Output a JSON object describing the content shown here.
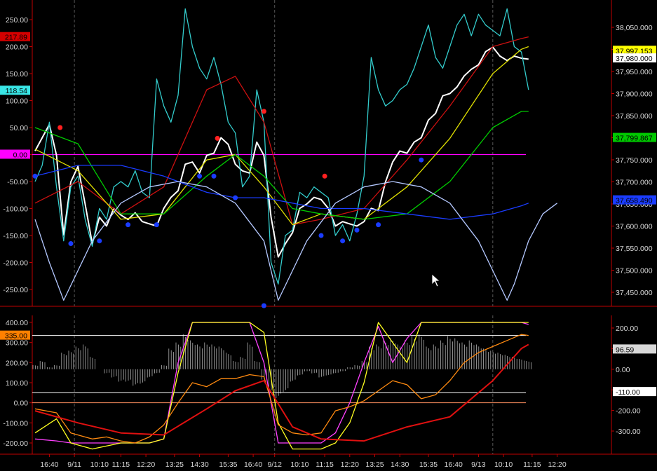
{
  "chart_data": [
    {
      "type": "line",
      "panel": "price",
      "left_axis": {
        "ticks": [
          250,
          200,
          150,
          100,
          50,
          0,
          -50,
          -100,
          -150,
          -200,
          -250
        ],
        "labels": [
          "250.00",
          "200.00",
          "150.00",
          "100.00",
          "50.00",
          "0.00",
          "-50.00",
          "-100.00",
          "-150.00",
          "-200.00",
          "-250.00"
        ]
      },
      "right_axis": {
        "ticks": [
          38050,
          38000,
          37950,
          37900,
          37850,
          37800,
          37750,
          37700,
          37650,
          37600,
          37550,
          37500,
          37450
        ],
        "labels": [
          "38,050.000",
          "38,000.000",
          "37,950.000",
          "37,900.000",
          "37,850.000",
          "37,800.000",
          "37,750.000",
          "37,700.000",
          "37,650.000",
          "37,600.000",
          "37,550.000",
          "37,500.000",
          "37,450.000"
        ]
      },
      "left_tags": [
        {
          "text": "217.89",
          "value": 217.89,
          "bg": "#d40000",
          "fg": "#000000"
        },
        {
          "text": "118.54",
          "value": 118.54,
          "bg": "#39e6e6",
          "fg": "#000000"
        },
        {
          "text": "0.00",
          "value": 0,
          "bg": "#ff00ff",
          "fg": "#000000"
        }
      ],
      "right_tags": [
        {
          "text": "37,997.153",
          "value": 37997.153,
          "bg": "#ffff00",
          "fg": "#000000"
        },
        {
          "text": "37,980.000",
          "value": 37980,
          "bg": "#ffffff",
          "fg": "#000000"
        },
        {
          "text": "37,799.867",
          "value": 37799.867,
          "bg": "#00c800",
          "fg": "#000000"
        },
        {
          "text": "37,658.490",
          "value": 37658.49,
          "bg": "#1a3cff",
          "fg": "#000000"
        }
      ],
      "series": [
        {
          "name": "price",
          "color": "#ffffff",
          "x": [
            0,
            1,
            2,
            3,
            4,
            5,
            6,
            7,
            8,
            9,
            10,
            11,
            12,
            13,
            14,
            15,
            16,
            17,
            18,
            19,
            20,
            21,
            22,
            23,
            24,
            25,
            26,
            27,
            28,
            29,
            30,
            31,
            32,
            33,
            34,
            35,
            36,
            37,
            38,
            39,
            40,
            41,
            42,
            43,
            44,
            45,
            46,
            47,
            48,
            49,
            50,
            51,
            52,
            53,
            54,
            55,
            56,
            57,
            58,
            59,
            60,
            61,
            62,
            63,
            64,
            65,
            66,
            67,
            68,
            69
          ],
          "y": [
            37770,
            37800,
            37830,
            37760,
            37580,
            37700,
            37735,
            37650,
            37560,
            37620,
            37600,
            37640,
            37625,
            37615,
            37630,
            37610,
            37605,
            37600,
            37640,
            37665,
            37680,
            37740,
            37745,
            37720,
            37760,
            37765,
            37800,
            37785,
            37740,
            37725,
            37720,
            37790,
            37760,
            37620,
            37530,
            37560,
            37585,
            37640,
            37650,
            37665,
            37660,
            37640,
            37600,
            37610,
            37605,
            37600,
            37610,
            37640,
            37635,
            37700,
            37745,
            37770,
            37765,
            37790,
            37800,
            37840,
            37855,
            37895,
            37900,
            37915,
            37940,
            37955,
            37965,
            37995,
            38005,
            37985,
            37975,
            37985,
            37980,
            37978
          ]
        },
        {
          "name": "oscillator",
          "color": "#33cccc",
          "x": [
            0,
            1,
            2,
            3,
            4,
            5,
            6,
            7,
            8,
            9,
            10,
            11,
            12,
            13,
            14,
            15,
            16,
            17,
            18,
            19,
            20,
            21,
            22,
            23,
            24,
            25,
            26,
            27,
            28,
            29,
            30,
            31,
            32,
            33,
            34,
            35,
            36,
            37,
            38,
            39,
            40,
            41,
            42,
            43,
            44,
            45,
            46,
            47,
            48,
            49,
            50,
            51,
            52,
            53,
            54,
            55,
            56,
            57,
            58,
            59,
            60,
            61,
            62,
            63,
            64,
            65,
            66,
            67,
            68,
            69
          ],
          "y": [
            -50,
            -20,
            60,
            -60,
            -160,
            -60,
            -40,
            -120,
            -170,
            -100,
            -120,
            -60,
            -50,
            -60,
            -30,
            -70,
            -80,
            140,
            90,
            60,
            110,
            270,
            200,
            160,
            140,
            180,
            130,
            60,
            40,
            -60,
            -40,
            120,
            60,
            -200,
            -240,
            -150,
            -140,
            -70,
            -80,
            -60,
            -70,
            -80,
            -150,
            -130,
            -160,
            -110,
            -40,
            180,
            120,
            90,
            100,
            120,
            130,
            160,
            200,
            240,
            180,
            160,
            200,
            240,
            260,
            220,
            260,
            240,
            230,
            220,
            270,
            200,
            190,
            120
          ]
        },
        {
          "name": "red-average",
          "color": "#cc1010",
          "x": [
            0,
            6,
            12,
            18,
            24,
            28,
            32,
            36,
            40,
            46,
            52,
            58,
            64,
            68,
            69
          ],
          "y": [
            -90,
            -50,
            -110,
            -60,
            120,
            145,
            60,
            -130,
            -120,
            -100,
            -10,
            90,
            200,
            215,
            218
          ]
        },
        {
          "name": "yellow-average",
          "color": "#e0e000",
          "x": [
            0,
            6,
            12,
            18,
            24,
            28,
            32,
            36,
            40,
            46,
            52,
            58,
            64,
            68,
            69
          ],
          "y": [
            10,
            -30,
            -120,
            -110,
            -10,
            0,
            -60,
            -130,
            -110,
            -120,
            -60,
            30,
            150,
            195,
            200
          ]
        },
        {
          "name": "green-average",
          "color": "#00cc00",
          "x": [
            0,
            6,
            12,
            18,
            24,
            28,
            32,
            36,
            40,
            46,
            52,
            58,
            64,
            68,
            69
          ],
          "y": [
            50,
            20,
            -110,
            -110,
            -40,
            0,
            -40,
            -100,
            -110,
            -120,
            -110,
            -50,
            50,
            80,
            80
          ]
        },
        {
          "name": "blue-average",
          "color": "#1a3cff",
          "x": [
            0,
            6,
            12,
            18,
            24,
            28,
            32,
            36,
            40,
            46,
            52,
            58,
            64,
            68,
            69
          ],
          "y": [
            -40,
            -20,
            -20,
            -40,
            -70,
            -80,
            -80,
            -90,
            -100,
            -100,
            -110,
            -120,
            -110,
            -95,
            -90
          ]
        },
        {
          "name": "cycle-arcs",
          "color": "#b4c8ff",
          "x": [
            0,
            2,
            4,
            8,
            12,
            16,
            20,
            24,
            28,
            32,
            34,
            38,
            42,
            46,
            50,
            54,
            58,
            62,
            66,
            67,
            69,
            71,
            73
          ],
          "y": [
            -120,
            -200,
            -270,
            -160,
            -90,
            -60,
            -50,
            -60,
            -90,
            -160,
            -270,
            -160,
            -90,
            -60,
            -50,
            -60,
            -90,
            -160,
            -270,
            -240,
            -160,
            -110,
            -90
          ]
        }
      ],
      "markers": [
        {
          "color": "#ff2020",
          "x": [
            3.5,
            25.5,
            32,
            40.5
          ],
          "y": [
            50,
            30,
            80,
            -40
          ]
        },
        {
          "color": "#1a3cff",
          "x": [
            0,
            5,
            9,
            13,
            17,
            23,
            25,
            28,
            32,
            40,
            43,
            45,
            48,
            54
          ],
          "y": [
            -40,
            -165,
            -160,
            -130,
            -130,
            -40,
            -40,
            -80,
            -280,
            -150,
            -160,
            -140,
            -130,
            -10
          ]
        }
      ],
      "hlines": [
        {
          "value": 0,
          "color": "#ff00ff"
        }
      ],
      "dashed_verticals_at_x": [
        5.5,
        33.5,
        64
      ]
    },
    {
      "type": "line",
      "panel": "oscillators",
      "left_axis": {
        "ticks": [
          400,
          300,
          200,
          100,
          0,
          -100,
          -200
        ],
        "labels": [
          "400.00",
          "300.00",
          "200.00",
          "100.00",
          "0.00",
          "-100.00",
          "-200.00"
        ]
      },
      "right_axis": {
        "ticks": [
          200,
          100,
          0,
          -100,
          -200,
          -300
        ],
        "labels": [
          "200.00",
          "100.00",
          "0.00",
          "-100.00",
          "-200.00",
          "-300.00"
        ]
      },
      "left_tags": [
        {
          "text": "335.00",
          "value": 335,
          "bg": "#ff8000",
          "fg": "#000000"
        }
      ],
      "right_tags": [
        {
          "text": "96.59",
          "value": 96.59,
          "bg": "#d8d8d8",
          "fg": "#000000"
        },
        {
          "text": "-110.00",
          "value": -110,
          "bg": "#ffffff",
          "fg": "#000000"
        }
      ],
      "histogram": {
        "color": "#b0b0b0",
        "base": 0,
        "values": [
          20,
          40,
          10,
          20,
          80,
          90,
          110,
          120,
          60,
          0,
          -20,
          -40,
          -60,
          -60,
          -80,
          -70,
          -40,
          -20,
          20,
          100,
          130,
          170,
          140,
          120,
          130,
          120,
          110,
          80,
          40,
          60,
          130,
          40,
          -50,
          -110,
          -140,
          -110,
          -60,
          -30,
          -10,
          -20,
          -40,
          -30,
          -20,
          -10,
          10,
          20,
          40,
          110,
          120,
          140,
          150,
          120,
          140,
          160,
          170,
          110,
          120,
          140,
          160,
          150,
          130,
          140,
          120,
          100,
          90,
          80,
          70,
          60,
          50,
          40
        ]
      },
      "series": [
        {
          "name": "stochastic-pink",
          "color": "#ff40ff",
          "x": [
            0,
            3,
            5,
            8,
            12,
            16,
            18,
            20,
            22,
            26,
            28,
            30,
            32,
            34,
            36,
            38,
            40,
            42,
            44,
            46,
            48,
            50,
            52,
            54,
            56,
            58,
            60,
            62,
            64,
            66,
            68,
            69
          ],
          "y": [
            -180,
            -190,
            -200,
            -200,
            -200,
            -200,
            -180,
            200,
            400,
            400,
            400,
            400,
            200,
            -200,
            -200,
            -200,
            -200,
            -150,
            0,
            200,
            380,
            200,
            320,
            400,
            400,
            400,
            400,
            400,
            400,
            400,
            400,
            390
          ]
        },
        {
          "name": "stochastic-yellow",
          "color": "#ffff20",
          "x": [
            0,
            3,
            5,
            8,
            12,
            16,
            18,
            20,
            22,
            26,
            28,
            30,
            32,
            34,
            36,
            38,
            40,
            42,
            44,
            46,
            48,
            50,
            52,
            54,
            56,
            58,
            60,
            62,
            64,
            66,
            68,
            69
          ],
          "y": [
            -150,
            -80,
            -200,
            -230,
            -200,
            -200,
            -180,
            150,
            400,
            400,
            400,
            400,
            350,
            -100,
            -230,
            -230,
            -230,
            -200,
            -100,
            100,
            400,
            300,
            200,
            400,
            400,
            400,
            400,
            400,
            400,
            400,
            400,
            400
          ]
        },
        {
          "name": "momentum-orange",
          "color": "#ff8a10",
          "x": [
            0,
            3,
            5,
            8,
            10,
            12,
            14,
            16,
            18,
            20,
            22,
            24,
            26,
            28,
            30,
            32,
            34,
            36,
            38,
            40,
            42,
            44,
            46,
            48,
            50,
            52,
            54,
            56,
            58,
            60,
            62,
            64,
            66,
            68,
            69
          ],
          "y": [
            -30,
            -50,
            -150,
            -180,
            -170,
            -190,
            -200,
            -170,
            -110,
            0,
            100,
            80,
            120,
            120,
            140,
            130,
            -110,
            -150,
            -160,
            -150,
            -40,
            -20,
            10,
            60,
            110,
            90,
            20,
            40,
            110,
            200,
            250,
            280,
            310,
            340,
            335
          ]
        },
        {
          "name": "signal-red",
          "color": "#e01010",
          "x": [
            0,
            6,
            12,
            18,
            24,
            28,
            32,
            36,
            40,
            46,
            52,
            58,
            64,
            68,
            69
          ],
          "y": [
            -40,
            -100,
            -150,
            -160,
            -30,
            60,
            110,
            -120,
            -180,
            -190,
            -120,
            -70,
            110,
            270,
            290
          ]
        }
      ],
      "hlines": [
        {
          "value": 335,
          "color": "#ffffff"
        },
        {
          "value": 50,
          "color": "#ffffff"
        },
        {
          "value": 0,
          "color": "#ff9060"
        }
      ],
      "dashed_verticals_at_x": [
        5.5,
        33.5,
        64
      ]
    }
  ],
  "x_axis": {
    "labels": [
      "16:40",
      "9/11",
      "10:10",
      "11:15",
      "12:20",
      "13:25",
      "14:30",
      "15:35",
      "16:40",
      "9/12",
      "10:10",
      "11:15",
      "12:20",
      "13:25",
      "14:30",
      "15:35",
      "16:40",
      "9/13",
      "10:10",
      "11:15",
      "12:20"
    ],
    "positions": [
      2,
      5.5,
      9,
      12,
      15.5,
      19.5,
      23,
      27,
      30.5,
      33.5,
      37,
      40.5,
      44,
      47.5,
      51,
      55,
      58.5,
      62,
      65.5,
      69.5,
      73
    ]
  }
}
